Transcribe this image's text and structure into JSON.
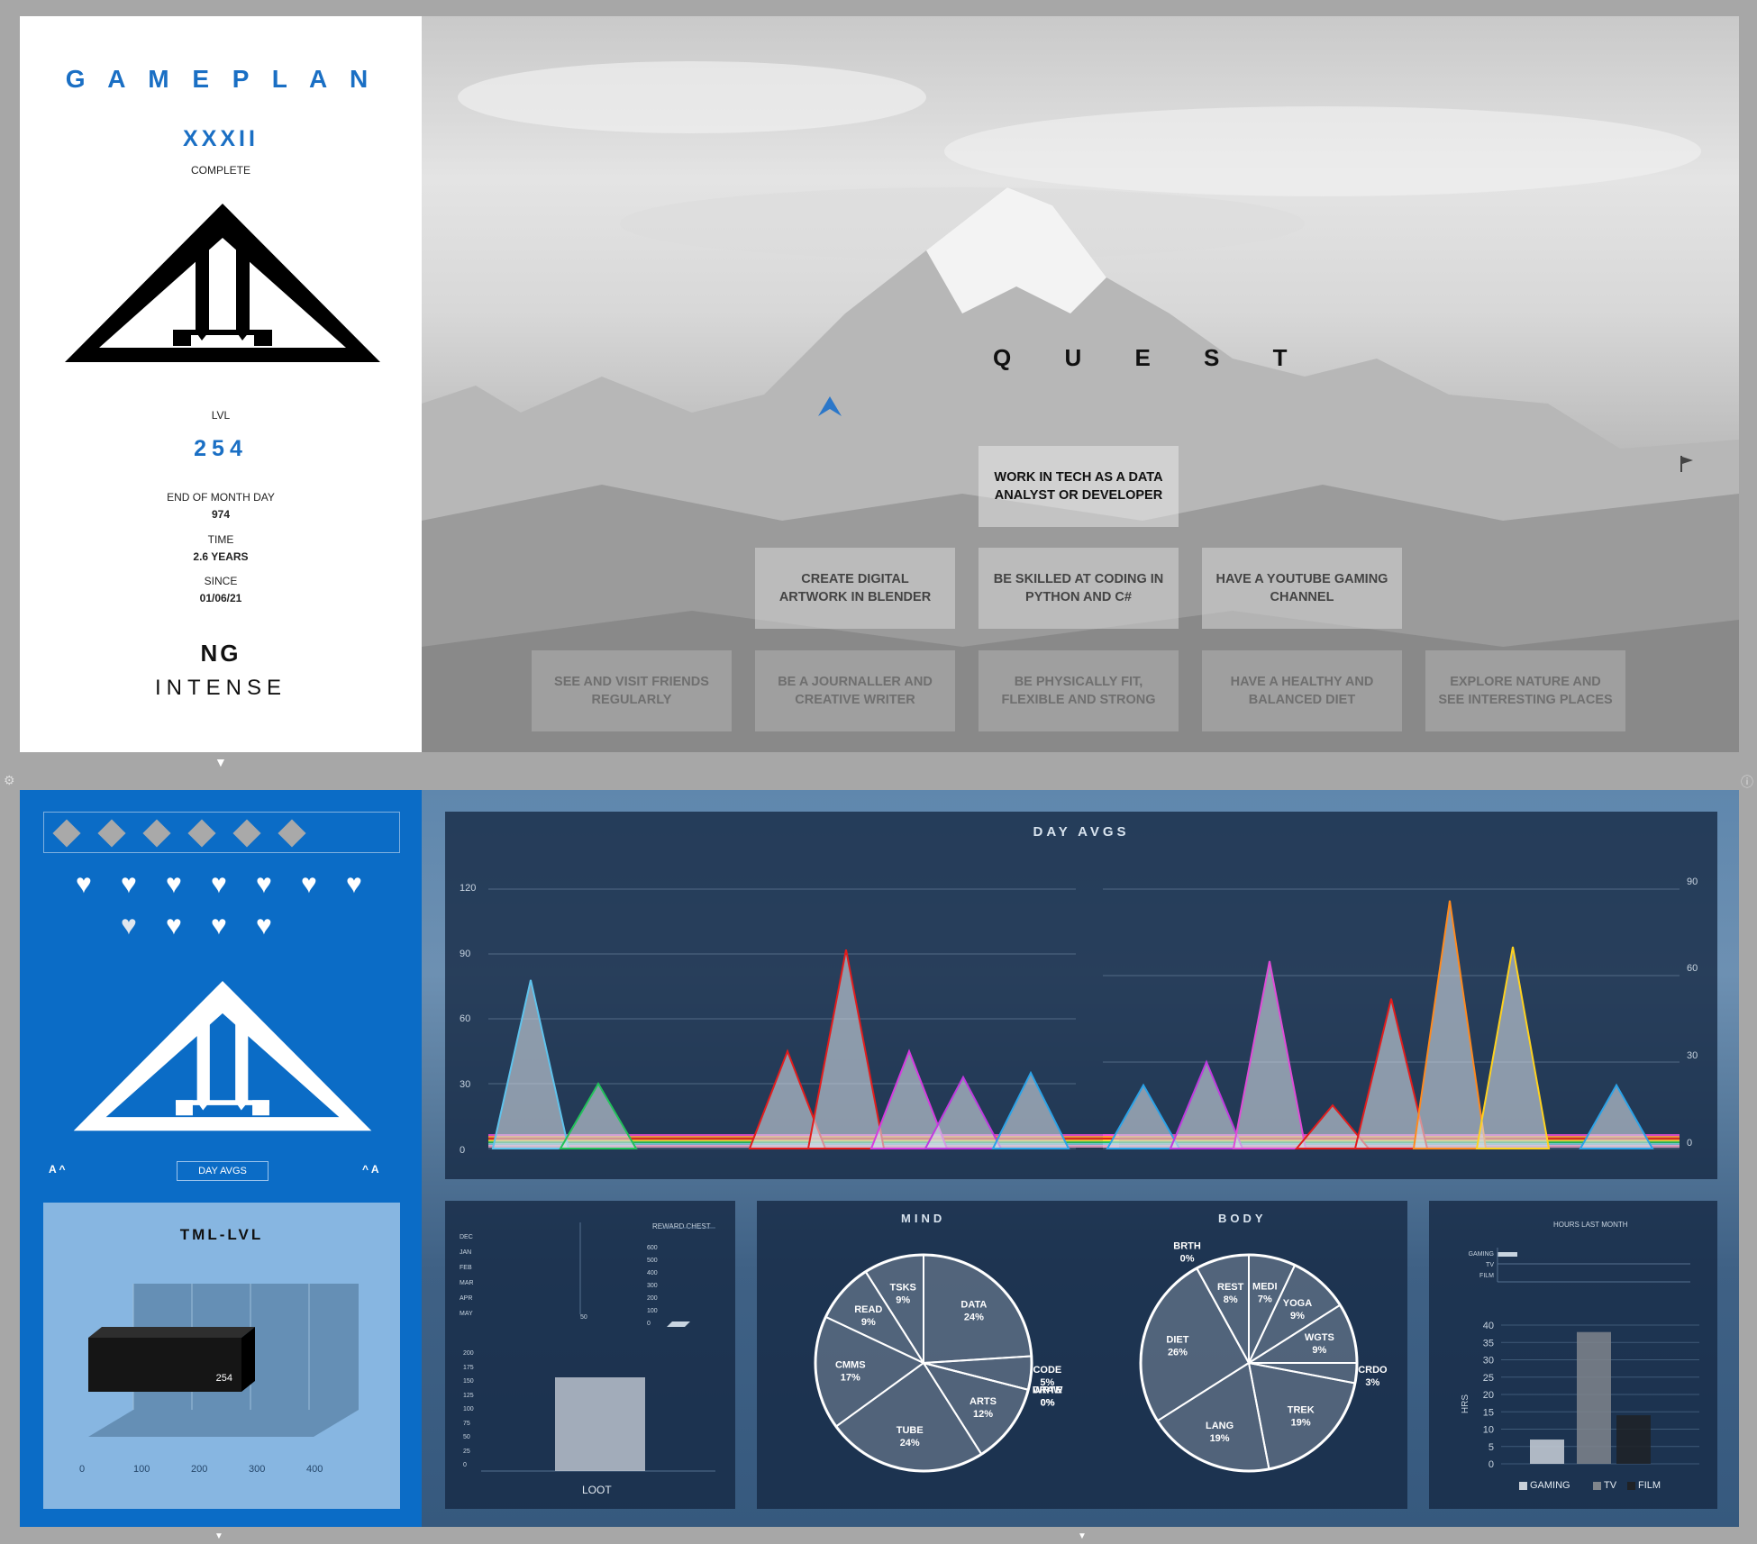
{
  "gameplan": {
    "title": "G A M E P L A N",
    "numeral": "XXXII",
    "complete_label": "COMPLETE",
    "lvl_label": "LVL",
    "lvl_value": "254",
    "eom_label": "END OF MONTH DAY",
    "eom_value": "974",
    "time_label": "TIME",
    "time_value": "2.6 YEARS",
    "since_label": "SINCE",
    "since_value": "01/06/21",
    "initials": "NG",
    "mode": "INTENSE"
  },
  "quest": {
    "title": "Q U E S T",
    "goals": [
      "WORK IN TECH AS A DATA ANALYST OR DEVELOPER",
      "CREATE DIGITAL ARTWORK IN BLENDER",
      "BE SKILLED AT CODING IN PYTHON AND C#",
      "HAVE A YOUTUBE GAMING CHANNEL",
      "SEE AND VISIT FRIENDS REGULARLY",
      "BE A JOURNALLER AND CREATIVE WRITER",
      "BE PHYSICALLY FIT, FLEXIBLE AND STRONG",
      "HAVE A HEALTHY AND BALANCED DIET",
      "EXPLORE NATURE AND SEE INTERESTING PLACES"
    ]
  },
  "sidebar": {
    "diamonds": 6,
    "hearts_row1": 7,
    "hearts_row2": 4,
    "left_marker": "A ^",
    "right_marker": "^ A",
    "selector": "DAY AVGS"
  },
  "colors": {
    "top_background": "#a7a7a7",
    "brand_blue": "#1a6fc4",
    "sidebar_blue": "#0b6cc6",
    "panel": "#142842"
  },
  "tml_lvl": {
    "title": "TML-LVL",
    "value": "254",
    "x_ticks": [
      "0",
      "100",
      "200",
      "300",
      "400"
    ]
  },
  "day_avgs": {
    "title": "DAY AVGS",
    "left_axis": [
      "0",
      "30",
      "60",
      "90",
      "120"
    ],
    "right_axis": [
      "0",
      "30",
      "60",
      "90"
    ]
  },
  "loot": {
    "label": "LOOT",
    "reward_chest": "REWARD CHEST",
    "months": [
      "DEC",
      "JAN",
      "FEB",
      "MAR",
      "APR",
      "MAY"
    ],
    "y_ticks": [
      "200",
      "175",
      "150",
      "125",
      "100",
      "75",
      "50",
      "25",
      "0"
    ],
    "reward_ticks": [
      "600",
      "500",
      "400",
      "300",
      "200",
      "100",
      "0"
    ],
    "x_tick": "50"
  },
  "hours": {
    "title": "HOURS LAST MONTH",
    "rows": [
      "GAMING",
      "TV",
      "FILM"
    ],
    "y_ticks": [
      "0",
      "5",
      "10",
      "15",
      "20",
      "25",
      "30",
      "35",
      "40"
    ],
    "y_label": "HRS",
    "legend": [
      "GAMING",
      "TV",
      "FILM"
    ]
  },
  "chart_data": [
    {
      "type": "pie",
      "title": "MIND",
      "labels": [
        "DATA",
        "CODE",
        "WRTE",
        "DRAW",
        "ARTS",
        "TUBE",
        "CMMS",
        "READ",
        "TSKS"
      ],
      "values": [
        24,
        5,
        0,
        0,
        12,
        24,
        17,
        9,
        9
      ],
      "percent_labels": [
        "24%",
        "5%",
        "0%",
        "0%",
        "12%",
        "24%",
        "17%",
        "9%",
        "9%"
      ]
    },
    {
      "type": "pie",
      "title": "BODY",
      "labels": [
        "MEDI",
        "YOGA",
        "WGTS",
        "CRDO",
        "TREK",
        "LANG",
        "DIET",
        "BRTH",
        "REST"
      ],
      "values": [
        7,
        9,
        9,
        3,
        19,
        19,
        26,
        0,
        8
      ],
      "percent_labels": [
        "7%",
        "9%",
        "9%",
        "3%",
        "19%",
        "19%",
        "26%",
        "0%",
        "8%"
      ]
    },
    {
      "type": "bar",
      "title": "",
      "categories": [
        "GAMING",
        "TV",
        "FILM"
      ],
      "values": [
        7,
        38,
        14
      ],
      "ylim": [
        0,
        40
      ],
      "ylabel": "HRS"
    },
    {
      "type": "bar",
      "title": "TML-LVL",
      "categories": [
        ""
      ],
      "values": [
        254
      ],
      "xlim": [
        0,
        400
      ]
    },
    {
      "type": "area",
      "title": "DAY AVGS",
      "left_peaks": [
        78,
        30,
        45,
        92,
        45,
        33,
        35
      ],
      "right_peaks": [
        22,
        30,
        65,
        15,
        52,
        86,
        70,
        22
      ],
      "ylim_left": [
        0,
        120
      ],
      "ylim_right": [
        0,
        90
      ]
    }
  ]
}
